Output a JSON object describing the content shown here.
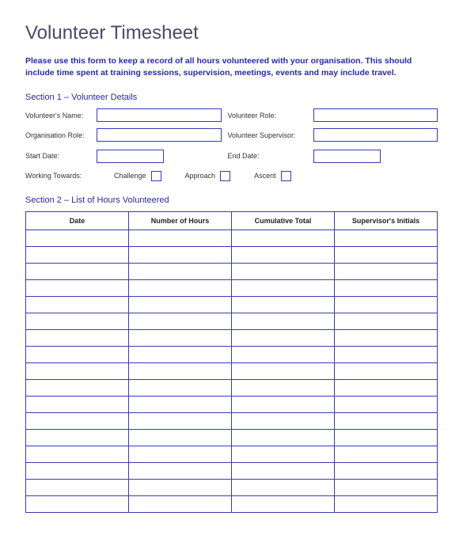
{
  "title": "Volunteer Timesheet",
  "instructions": "Please use this form to keep a record of all hours volunteered with your organisation. This should include time spent at training sessions, supervision, meetings, events and may include travel.",
  "section1": {
    "header": "Section 1 – Volunteer Details",
    "labels": {
      "name": "Volunteer's Name:",
      "role": "Volunteer Role:",
      "orgRole": "Organisation Role:",
      "supervisor": "Volunteer Supervisor:",
      "startDate": "Start Date:",
      "endDate": "End Date:",
      "workingTowards": "Working Towards:",
      "challenge": "Challenge",
      "approach": "Approach",
      "ascent": "Ascent"
    },
    "values": {
      "name": "",
      "role": "",
      "orgRole": "",
      "supervisor": "",
      "startDate": "",
      "endDate": "",
      "challenge": false,
      "approach": false,
      "ascent": false
    }
  },
  "section2": {
    "header": "Section 2 – List of Hours Volunteered",
    "columns": [
      "Date",
      "Number of Hours",
      "Cumulative Total",
      "Supervisor's Initials"
    ],
    "rows": [
      [
        "",
        "",
        "",
        ""
      ],
      [
        "",
        "",
        "",
        ""
      ],
      [
        "",
        "",
        "",
        ""
      ],
      [
        "",
        "",
        "",
        ""
      ],
      [
        "",
        "",
        "",
        ""
      ],
      [
        "",
        "",
        "",
        ""
      ],
      [
        "",
        "",
        "",
        ""
      ],
      [
        "",
        "",
        "",
        ""
      ],
      [
        "",
        "",
        "",
        ""
      ],
      [
        "",
        "",
        "",
        ""
      ],
      [
        "",
        "",
        "",
        ""
      ],
      [
        "",
        "",
        "",
        ""
      ],
      [
        "",
        "",
        "",
        ""
      ],
      [
        "",
        "",
        "",
        ""
      ],
      [
        "",
        "",
        "",
        ""
      ],
      [
        "",
        "",
        "",
        ""
      ],
      [
        "",
        "",
        "",
        ""
      ]
    ]
  }
}
